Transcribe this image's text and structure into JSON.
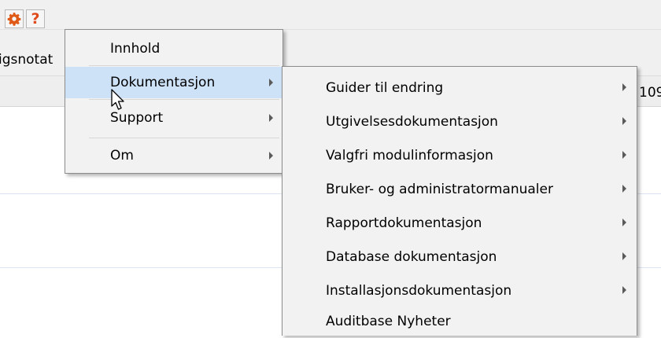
{
  "toolbar": {
    "buttons": [
      {
        "icon": "gear-icon",
        "color": "#e05a17"
      },
      {
        "icon": "help-icon",
        "glyph": "?",
        "color": "#e04a1b"
      }
    ]
  },
  "tabs": {
    "partial_label": "igsnotat"
  },
  "grid": {
    "header_partial_text": "109"
  },
  "menu": {
    "items": [
      {
        "label": "Innhold",
        "has_submenu": false
      },
      {
        "label": "Dokumentasjon",
        "has_submenu": true,
        "highlighted": true
      },
      {
        "label": "Support",
        "has_submenu": true
      },
      {
        "label": "Om",
        "has_submenu": true
      }
    ]
  },
  "submenu": {
    "items": [
      {
        "label": "Guider til endring",
        "has_submenu": true
      },
      {
        "label": "Utgivelsesdokumentasjon",
        "has_submenu": true
      },
      {
        "label": "Valgfri modulinformasjon",
        "has_submenu": true
      },
      {
        "label": "Bruker- og administratormanualer",
        "has_submenu": true
      },
      {
        "label": "Rapportdokumentasjon",
        "has_submenu": true
      },
      {
        "label": "Database dokumentasjon",
        "has_submenu": true
      },
      {
        "label": "Installasjonsdokumentasjon",
        "has_submenu": true
      },
      {
        "label": "Auditbase Nyheter",
        "has_submenu": false
      }
    ]
  },
  "colors": {
    "highlight": "#cde1f7",
    "menu_background": "#f2f2f2",
    "accent": "#e05a17"
  }
}
